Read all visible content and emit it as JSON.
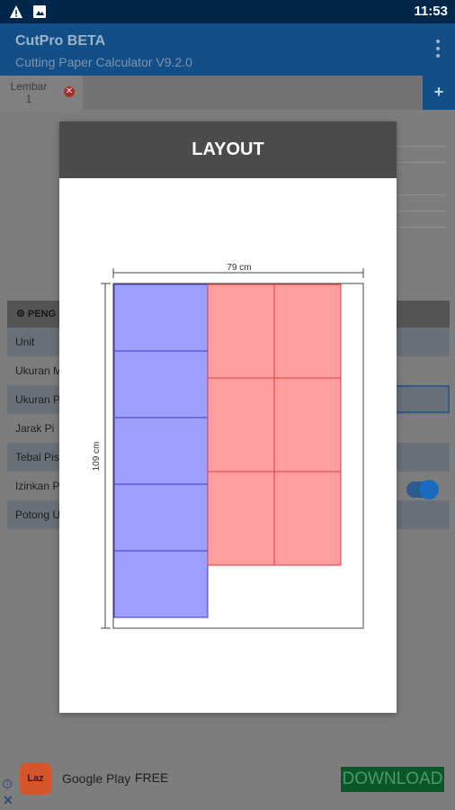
{
  "status_bar": {
    "time": "11:53"
  },
  "app_bar": {
    "title": "CutPro BETA",
    "subtitle": "Cutting Paper Calculator V9.2.0"
  },
  "tabs": [
    {
      "label": "Lembar 1"
    }
  ],
  "settings": {
    "header": "PENG",
    "rows": [
      "Unit",
      "Ukuran M",
      "Ukuran P",
      "Jarak Pi",
      "Tebal Pis",
      "Izinkan P",
      "Potong U"
    ]
  },
  "dialog": {
    "title": "LAYOUT",
    "sheet_width_label": "79 cm",
    "sheet_height_label": "109 cm",
    "colors": {
      "blue_piece": "#9e9eff",
      "red_piece": "#ff9e9e",
      "blue_line": "#3b3bd6",
      "red_line": "#e23b3b"
    },
    "blue_grid": {
      "columns": 1,
      "rows": 5
    },
    "red_grid": {
      "columns": 2,
      "rows": 3
    }
  },
  "ad": {
    "store": "Google Play",
    "price": "FREE",
    "cta": "DOWNLOAD",
    "logo_text": "Laz"
  }
}
